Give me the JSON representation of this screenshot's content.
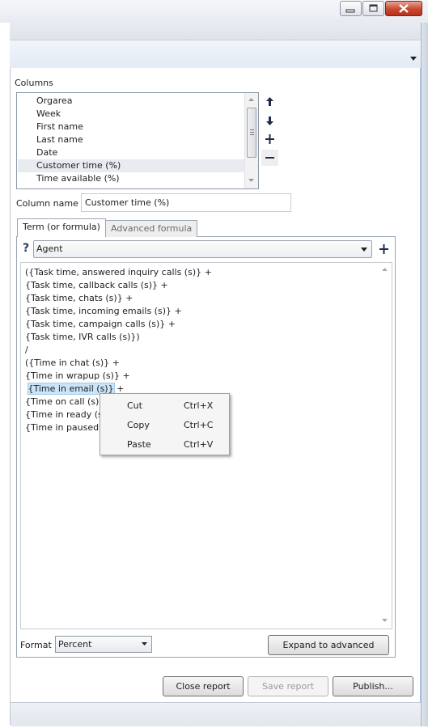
{
  "columns": {
    "label": "Columns",
    "items": [
      "Orgarea",
      "Week",
      "First name",
      "Last name",
      "Date",
      "Customer time (%)",
      "Time available (%)"
    ],
    "selected_index": 5
  },
  "column_name": {
    "label": "Column name",
    "value": "Customer time (%)"
  },
  "tabs": [
    "Term (or formula)",
    "Advanced formula"
  ],
  "term": {
    "help": "?",
    "combo_value": "Agent"
  },
  "formula": {
    "lines": [
      "({Task time, answered inquiry calls (s)} +",
      " {Task time, callback calls (s)} +",
      " {Task time, chats (s)} +",
      " {Task time, incoming emails (s)} +",
      " {Task time, campaign calls (s)} +",
      " {Task time, IVR calls (s)})",
      "/",
      "({Time in chat (s)} +",
      " {Time in wrapup (s)} +",
      " {Time in email (s)} +",
      " {Time on call (s)}",
      " {Time in ready (s)",
      " {Time in paused ("
    ],
    "highlight": "{Time in email (s)}",
    "highlight_suffix": " +"
  },
  "context_menu": {
    "items": [
      {
        "label": "Cut",
        "shortcut": "Ctrl+X"
      },
      {
        "label": "Copy",
        "shortcut": "Ctrl+C"
      },
      {
        "label": "Paste",
        "shortcut": "Ctrl+V"
      }
    ]
  },
  "format": {
    "label": "Format",
    "value": "Percent"
  },
  "buttons": {
    "expand": "Expand to advanced",
    "close_report": "Close report",
    "save_report": "Save report",
    "publish": "Publish..."
  },
  "colors": {
    "highlight": "#cce4f7",
    "close_button": "#c8482e",
    "accent_border": "#a7c4e5"
  }
}
